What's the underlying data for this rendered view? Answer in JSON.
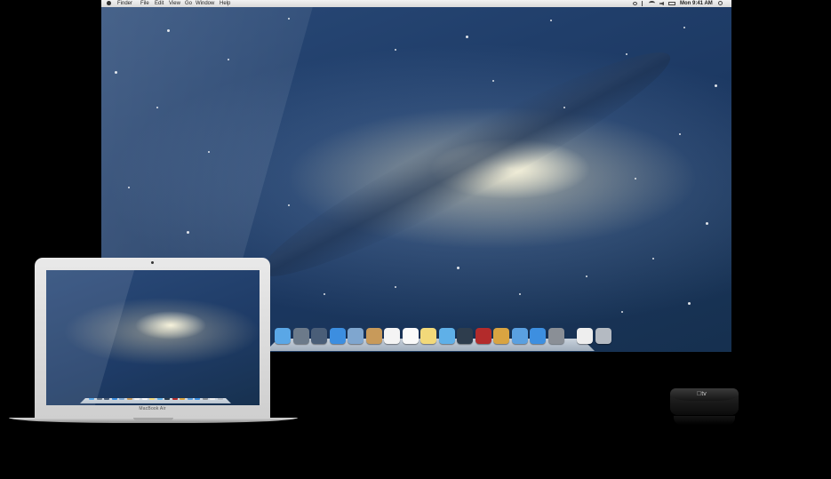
{
  "menubar": {
    "apple": "",
    "items": [
      "Finder",
      "File",
      "Edit",
      "View",
      "Go",
      "Window",
      "Help"
    ],
    "status_time": "Mon 9:41 AM",
    "status_icons": [
      "time-machine-icon",
      "bluetooth-icon",
      "wifi-icon",
      "volume-icon",
      "battery-icon"
    ]
  },
  "dock": {
    "icons": [
      {
        "name": "finder",
        "color": "#5aa7e6"
      },
      {
        "name": "launchpad",
        "color": "#6c7a8a"
      },
      {
        "name": "mission-control",
        "color": "#4a5e78"
      },
      {
        "name": "safari",
        "color": "#3c8ee0"
      },
      {
        "name": "mail",
        "color": "#7fa6cf"
      },
      {
        "name": "contacts",
        "color": "#c89a5a"
      },
      {
        "name": "calendar",
        "color": "#f4f4f4"
      },
      {
        "name": "reminders",
        "color": "#fafafa"
      },
      {
        "name": "notes",
        "color": "#f2d97a"
      },
      {
        "name": "messages",
        "color": "#5fb0e8"
      },
      {
        "name": "facetime",
        "color": "#2e3d4d"
      },
      {
        "name": "photo-booth",
        "color": "#b32b2b"
      },
      {
        "name": "iphoto",
        "color": "#d9a441"
      },
      {
        "name": "itunes",
        "color": "#5aa0e0"
      },
      {
        "name": "app-store",
        "color": "#3d8fe0"
      },
      {
        "name": "system-preferences",
        "color": "#8a8f96"
      },
      {
        "name": "documents",
        "color": "#eeeeee"
      },
      {
        "name": "trash",
        "color": "#b4bac2"
      }
    ]
  },
  "macbook": {
    "label": "MacBook Air"
  },
  "apple_tv": {
    "logo": "tv"
  }
}
